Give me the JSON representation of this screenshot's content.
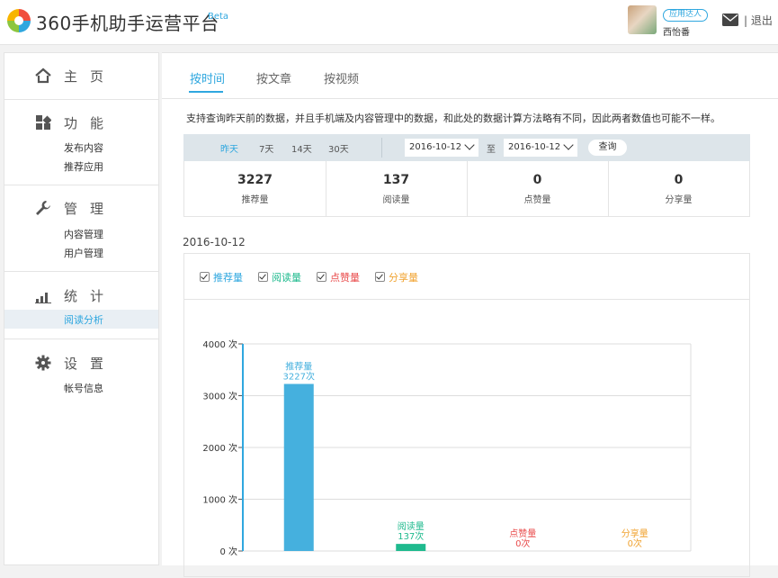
{
  "header": {
    "logo_text": "360手机助手运营平台",
    "beta": "Beta",
    "user_badge": "应用达人",
    "user_name": "西怡番",
    "logout": "| 退出"
  },
  "sidebar": {
    "sections": [
      {
        "title": "主页",
        "icon": "home-icon",
        "items": []
      },
      {
        "title": "功能",
        "icon": "grid-icon",
        "items": [
          "发布内容",
          "推荐应用"
        ]
      },
      {
        "title": "管理",
        "icon": "wrench-icon",
        "items": [
          "内容管理",
          "用户管理"
        ]
      },
      {
        "title": "统计",
        "icon": "bar-chart-icon",
        "items": [
          "阅读分析"
        ]
      },
      {
        "title": "设置",
        "icon": "gear-icon",
        "items": [
          "帐号信息"
        ]
      }
    ],
    "active_item": "阅读分析"
  },
  "tabs": [
    "按时间",
    "按文章",
    "按视频"
  ],
  "active_tab": "按时间",
  "note": "支持查询昨天前的数据，并且手机端及内容管理中的数据，和此处的数据计算方法略有不同，因此两者数值也可能不一样。",
  "filter": {
    "ranges": [
      "昨天",
      "7天",
      "14天",
      "30天"
    ],
    "active_range": "昨天",
    "start_date": "2016-10-12",
    "to_label": "至",
    "end_date": "2016-10-12",
    "query_button": "查询"
  },
  "stats": [
    {
      "value": "3227",
      "label": "推荐量"
    },
    {
      "value": "137",
      "label": "阅读量"
    },
    {
      "value": "0",
      "label": "点赞量"
    },
    {
      "value": "0",
      "label": "分享量"
    }
  ],
  "date_title": "2016-10-12",
  "legend": [
    {
      "label": "推荐量",
      "color": "#2fa7df",
      "checked": true
    },
    {
      "label": "阅读量",
      "color": "#1fba8e",
      "checked": true
    },
    {
      "label": "点赞量",
      "color": "#e94b4b",
      "checked": true
    },
    {
      "label": "分享量",
      "color": "#f0a331",
      "checked": true
    }
  ],
  "chart_data": {
    "type": "bar",
    "categories": [
      "推荐量",
      "阅读量",
      "点赞量",
      "分享量"
    ],
    "values": [
      3227,
      137,
      0,
      0
    ],
    "value_labels": [
      "3227次",
      "137次",
      "0次",
      "0次"
    ],
    "colors": [
      "#45b0de",
      "#1fba8e",
      "#e94b4b",
      "#f0a331"
    ],
    "ylim": [
      0,
      4000
    ],
    "yticks": [
      0,
      1000,
      2000,
      3000,
      4000
    ],
    "ytick_labels": [
      "0 次",
      "1000 次",
      "2000 次",
      "3000 次",
      "4000 次"
    ],
    "grid": true
  },
  "colors": {
    "accent": "#2fa7df"
  }
}
